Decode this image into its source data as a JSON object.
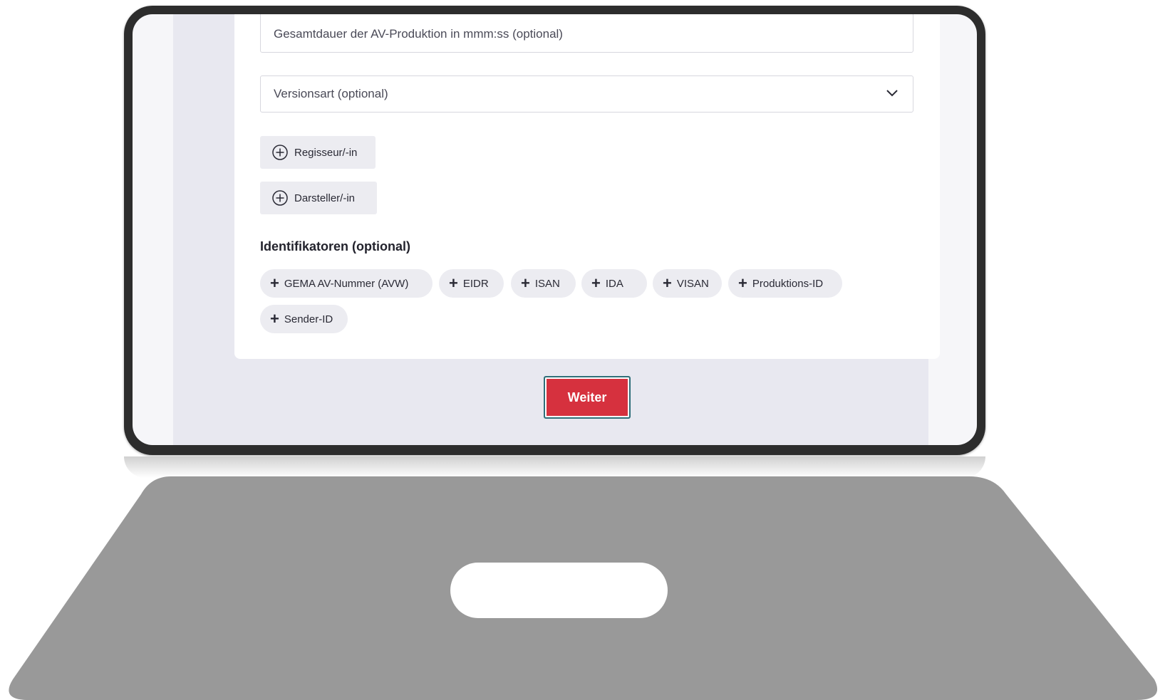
{
  "form": {
    "duration_placeholder": "Gesamtdauer der AV-Produktion in mmm:ss (optional)",
    "version_type_placeholder": "Versionsart (optional)",
    "add_director_label": "Regisseur/-in",
    "add_actor_label": "Darsteller/-in",
    "identifiers_heading": "Identifikatoren (optional)",
    "identifier_chips": [
      "GEMA AV-Nummer (AVW)",
      "EIDR",
      "ISAN",
      "IDA",
      "VISAN",
      "Produktions-ID",
      "Sender-ID"
    ],
    "next_button_label": "Weiter"
  },
  "icons": {
    "chevron": "chevron-down-icon",
    "circle_plus": "plus-circle-icon",
    "plus": "plus-icon"
  },
  "colors": {
    "primary_button": "#d6313e",
    "chip_background": "#ececf1",
    "page_background": "#e8e8f0",
    "laptop_frame": "#2d2d2d",
    "laptop_base": "#999999"
  }
}
